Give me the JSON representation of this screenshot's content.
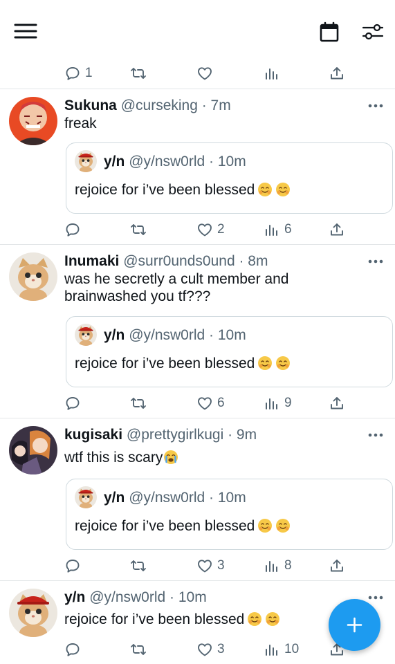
{
  "top_actions": {
    "reply_count": "1",
    "retweet_count": "",
    "like_count": "",
    "view_count": ""
  },
  "posts": [
    {
      "name": "Sukuna",
      "handle": "@curseking · 7m",
      "text": "freak",
      "avatar": "sukuna-avatar",
      "quote": {
        "name": "y/n",
        "handle": "@y/nsw0rld · 10m",
        "text": "rejoice for i’ve been blessed"
      },
      "stats": {
        "reply": "",
        "retweet": "",
        "like": "2",
        "views": "6"
      }
    },
    {
      "name": "Inumaki",
      "handle": "@surr0unds0und · 8m",
      "text_lines": [
        "was he secretly a cult member and",
        "brainwashed you tf???"
      ],
      "avatar": "cat-avatar",
      "quote": {
        "name": "y/n",
        "handle": "@y/nsw0rld · 10m",
        "text": "rejoice for i’ve been blessed"
      },
      "stats": {
        "reply": "",
        "retweet": "",
        "like": "6",
        "views": "9"
      }
    },
    {
      "name": "kugisaki",
      "handle": "@prettygirlkugi · 9m",
      "text": "wtf this is scary",
      "avatar": "anime-avatar",
      "quote": {
        "name": "y/n",
        "handle": "@y/nsw0rld · 10m",
        "text": "rejoice for i’ve been blessed"
      },
      "stats": {
        "reply": "",
        "retweet": "",
        "like": "3",
        "views": "8"
      }
    },
    {
      "name": "y/n",
      "handle": "@y/nsw0rld · 10m",
      "text": "rejoice for i’ve been blessed",
      "avatar": "cat-avatar",
      "stats": {
        "reply": "",
        "retweet": "",
        "like": "3",
        "views": "10"
      }
    }
  ],
  "icons": {
    "menu": "menu-icon",
    "calendar": "calendar-icon",
    "filter": "filter-icon",
    "compose": "plus-icon"
  },
  "colors": {
    "accent": "#1d9bf0",
    "text": "#0f1419",
    "muted": "#536471",
    "border": "#cfd9de"
  }
}
